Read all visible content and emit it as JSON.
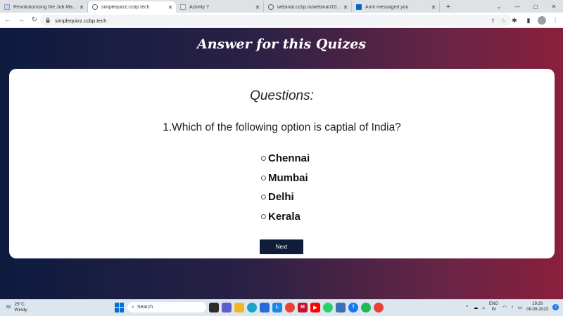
{
  "browser": {
    "tabs": [
      {
        "title": "Revolutionizing the Job Market |",
        "active": false,
        "favicon": "site-favicon"
      },
      {
        "title": "simplequizz.ccbp.tech",
        "active": true,
        "favicon": "globe-icon"
      },
      {
        "title": "Activity 7",
        "active": false,
        "favicon": "site-favicon"
      },
      {
        "title": "webinar.ccbp.in/webinar/10x-ac",
        "active": false,
        "favicon": "globe-icon"
      },
      {
        "title": "Amit messaged you",
        "active": false,
        "favicon": "linkedin-icon"
      }
    ],
    "url": "simplequizz.ccbp.tech"
  },
  "page": {
    "title": "Answer for this Quizes",
    "heading": "Questions:",
    "question": "1.Which of the following option is captial of India?",
    "options": [
      "Chennai",
      "Mumbai",
      "Delhi",
      "Kerala"
    ],
    "next_label": "Next"
  },
  "taskbar": {
    "weather_temp": "25°C",
    "weather_desc": "Windy",
    "search_placeholder": "Search",
    "lang_top": "ENG",
    "lang_bottom": "IN",
    "time": "19:26",
    "date": "08-09-2023",
    "notification_count": "2"
  },
  "colors": {
    "page_gradient_start": "#0d1b3f",
    "page_gradient_end": "#8a1f3c",
    "next_button": "#0f1d3a"
  }
}
